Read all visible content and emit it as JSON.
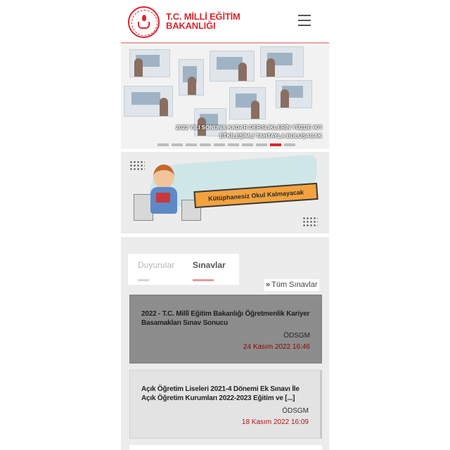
{
  "header": {
    "logo_line1": "T.C. MİLLİ EĞİTİM",
    "logo_line2": "BAKANLIĞI",
    "menu_icon": "hamburger-menu-icon"
  },
  "slider": {
    "caption": "2022 YILI SONUNA KADAR DERSLİKLERİN YÜZDE 90'I ETKİLEŞİMLİ TAHTAYLA BULUŞACAK",
    "slide_count": 10,
    "active_slide": 9
  },
  "banner": {
    "text": "Kütüphanesiz Okul Kalmayacak"
  },
  "tabs": {
    "items": [
      {
        "label": "Duyurular",
        "active": false
      },
      {
        "label": "Sınavlar",
        "active": true
      }
    ],
    "all_link": "Tüm Sınavlar",
    "all_link_icon": "double-chevron-right-icon"
  },
  "cards": [
    {
      "title": "2022 - T.C. Millî Eğitim Bakanlığı Öğretmenlik Kariyer Basamakları Sınav Sonucu",
      "source": "ÖDSGM",
      "date": "24 Kasım 2022 16:46"
    },
    {
      "title": "Açık Öğretim Liseleri 2021-4 Dönemi Ek Sınavı İle Açık Öğretim Kurumları 2022-2023 Eğitim ve [...]",
      "source": "ÖDSGM",
      "date": "18 Kasım 2022 16:09"
    }
  ],
  "colors": {
    "brand_red": "#d9282f",
    "date_red": "#b01515",
    "tab_accent": "#e89a9a"
  }
}
